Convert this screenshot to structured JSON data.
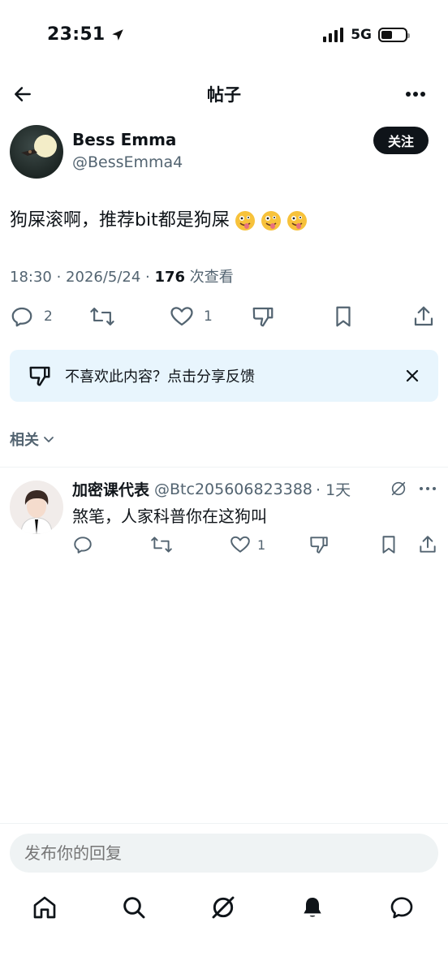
{
  "status_bar": {
    "time": "23:51",
    "network": "5G",
    "battery_level": 0.45
  },
  "header": {
    "title": "帖子"
  },
  "post": {
    "author_name": "Bess Emma",
    "author_handle": "@BessEmma4",
    "follow_label": "关注",
    "text": "狗屎滚啊，推荐bit都是狗屎",
    "emoji_count": 3,
    "meta_prefix": "18:30 · 2026/5/24 · ",
    "views": "176",
    "views_suffix": " 次查看",
    "reply_count": "2",
    "like_count": "1"
  },
  "feedback": {
    "text": "不喜欢此内容？点击分享反馈"
  },
  "related": {
    "label": "相关"
  },
  "reply": {
    "name": "加密课代表",
    "handle": "@Btc205606823388",
    "time": "· 1天",
    "text": "煞笔，人家科普你在这狗叫",
    "like_count": "1"
  },
  "composer": {
    "placeholder": "发布你的回复"
  },
  "colors": {
    "text_primary": "#0f1419",
    "text_secondary": "#536471",
    "banner_bg": "#e8f5fd",
    "input_bg": "#eff3f4"
  }
}
